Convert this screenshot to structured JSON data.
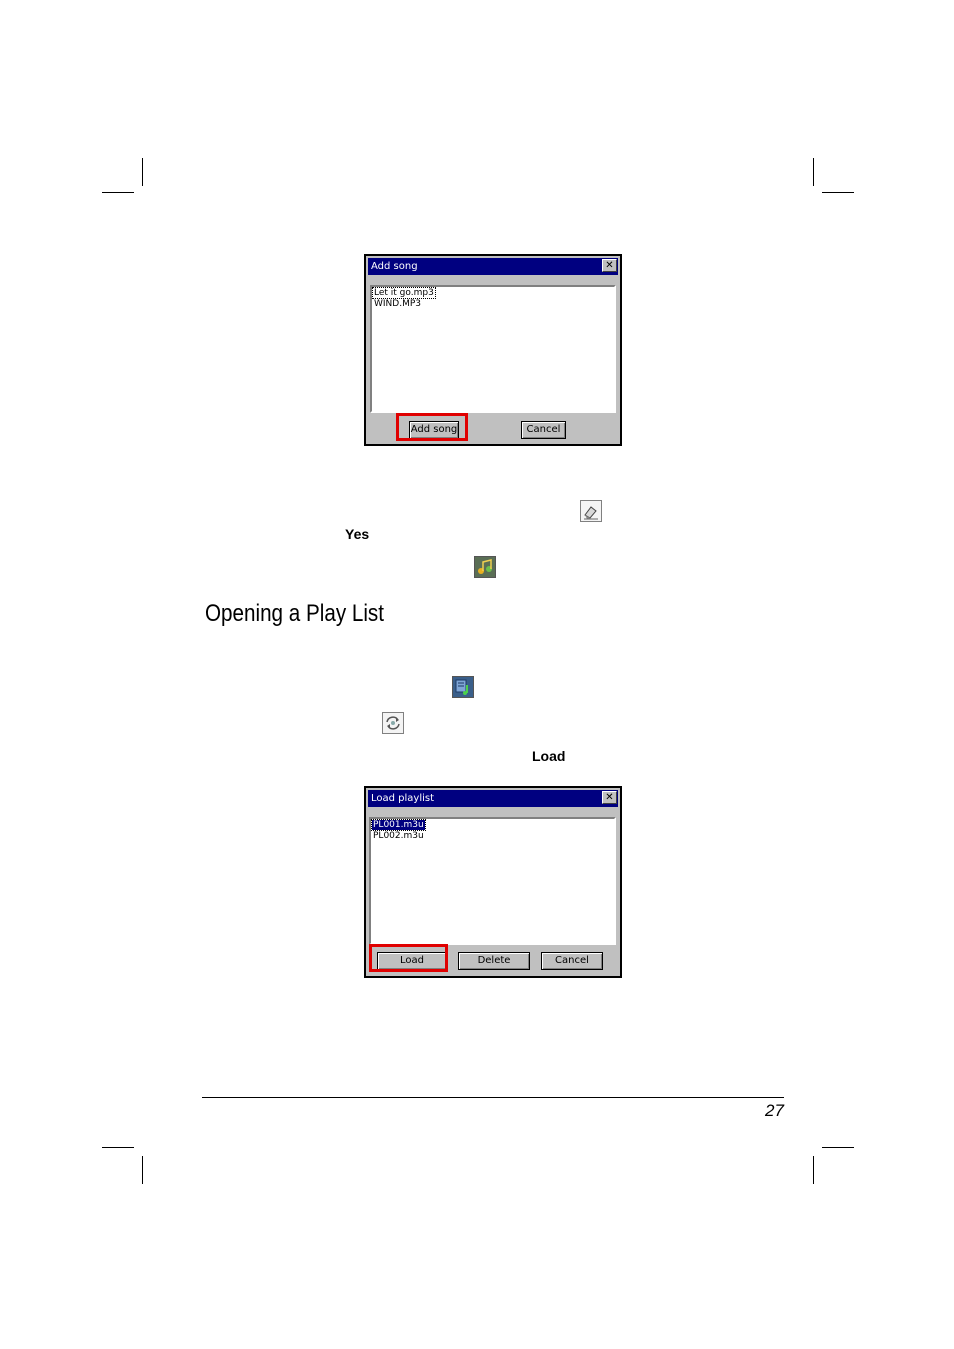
{
  "add_song_dialog": {
    "title": "Add song",
    "close_glyph": "✕",
    "files": [
      "Let it go.mp3",
      "WIND.MP3"
    ],
    "add_button": "Add song",
    "cancel_button": "Cancel"
  },
  "body_text": {
    "yes_label": "Yes",
    "load_label": "Load"
  },
  "heading": "Opening a Play List",
  "load_playlist_dialog": {
    "title": "Load playlist",
    "close_glyph": "✕",
    "files": [
      "PL001.m3u",
      "PL002.m3u"
    ],
    "load_button": "Load",
    "delete_button": "Delete",
    "cancel_button": "Cancel"
  },
  "footer": {
    "page_number": "27"
  },
  "colors": {
    "title_bar": "#000080",
    "highlight_red": "#e00000",
    "dialog_face": "#c0c0c0"
  },
  "icons": [
    "eraser-icon",
    "music-note-icon",
    "playlist-icon",
    "open-playlist-icon"
  ]
}
